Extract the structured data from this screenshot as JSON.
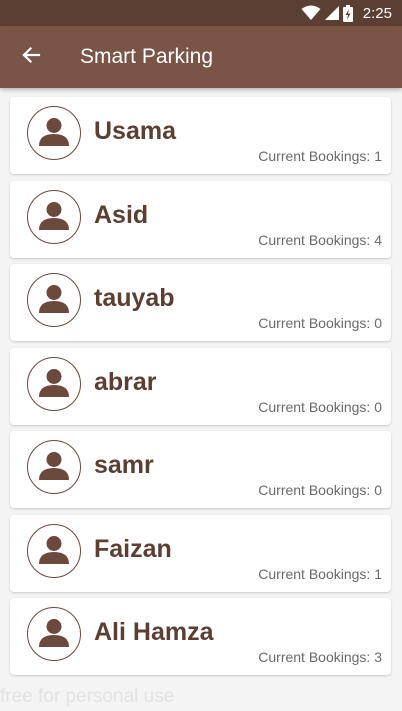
{
  "status_bar": {
    "time": "2:25",
    "icons": [
      "wifi-icon",
      "signal-icon",
      "battery-charging-icon"
    ]
  },
  "app_bar": {
    "back_icon": "arrow-back-icon",
    "title": "Smart Parking"
  },
  "users": [
    {
      "name": "Usama",
      "bookings_label": "Current Bookings: 1"
    },
    {
      "name": "Asid",
      "bookings_label": "Current Bookings: 4"
    },
    {
      "name": "tauyab",
      "bookings_label": "Current Bookings: 0"
    },
    {
      "name": "abrar",
      "bookings_label": "Current Bookings: 0"
    },
    {
      "name": "samr",
      "bookings_label": "Current Bookings: 0"
    },
    {
      "name": "Faizan",
      "bookings_label": "Current Bookings: 1"
    },
    {
      "name": "Ali Hamza",
      "bookings_label": "Current Bookings: 3"
    }
  ],
  "watermark": "free for personal use",
  "colors": {
    "status_bar": "#5c3f33",
    "app_bar": "#7a5546",
    "accent": "#6b4a3d",
    "background": "#f4f4f4"
  }
}
